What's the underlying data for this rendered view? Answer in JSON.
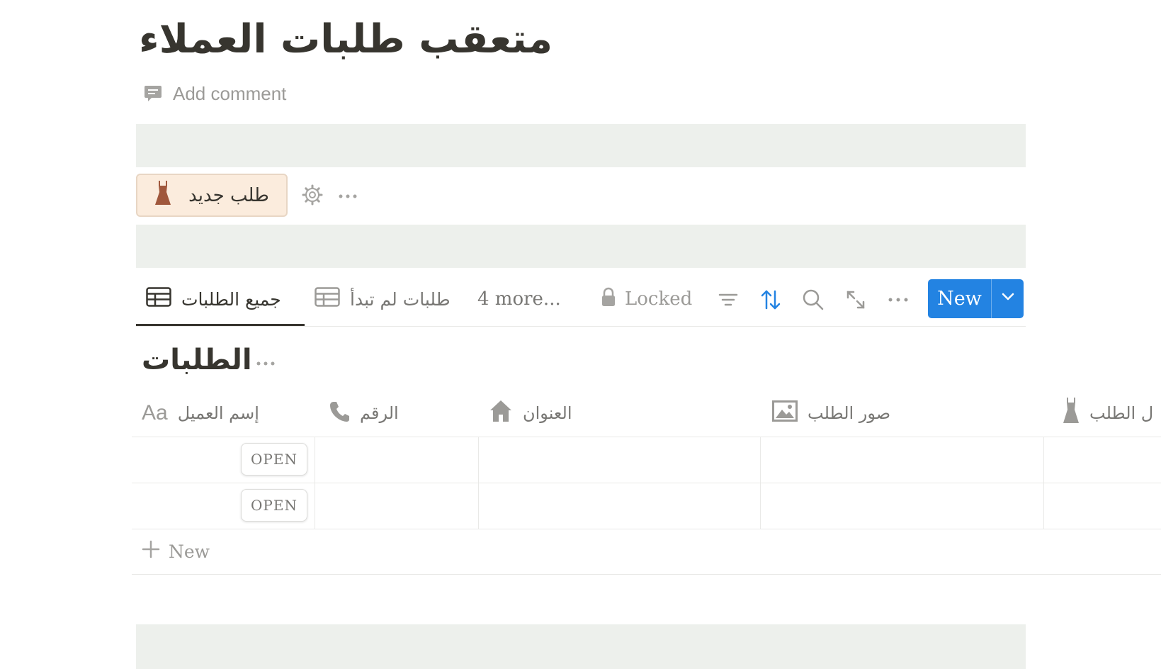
{
  "page": {
    "title": "متعقب طلبات العملاء",
    "add_comment": "Add comment"
  },
  "button_row": {
    "new_order_label": "طلب جديد",
    "new_order_icon": "dress-icon"
  },
  "views": {
    "tabs": [
      {
        "label": "جميع الطلبات",
        "icon": "table-icon",
        "active": true
      },
      {
        "label": "طلبات لم تبدأ",
        "icon": "table-icon",
        "active": false
      }
    ],
    "more_label": "4 more...",
    "locked_label": "Locked",
    "new_label": "New"
  },
  "database": {
    "title": "الطلبات",
    "columns": [
      {
        "label": "إسم العميل",
        "icon": "text-type-icon",
        "icon_text": "Aa"
      },
      {
        "label": "الرقم",
        "icon": "phone-icon"
      },
      {
        "label": "العنوان",
        "icon": "home-icon"
      },
      {
        "label": "صور الطلب",
        "icon": "image-icon"
      },
      {
        "label": "ل الطلب",
        "icon": "dress-icon"
      }
    ],
    "rows": [
      {
        "open_label": "OPEN"
      },
      {
        "open_label": "OPEN"
      }
    ],
    "add_row_label": "New"
  },
  "colors": {
    "accent": "#2383e2",
    "band": "#edf0ec",
    "callout_bg": "#fbecdd",
    "text": "#37352f",
    "muted": "#787774"
  }
}
